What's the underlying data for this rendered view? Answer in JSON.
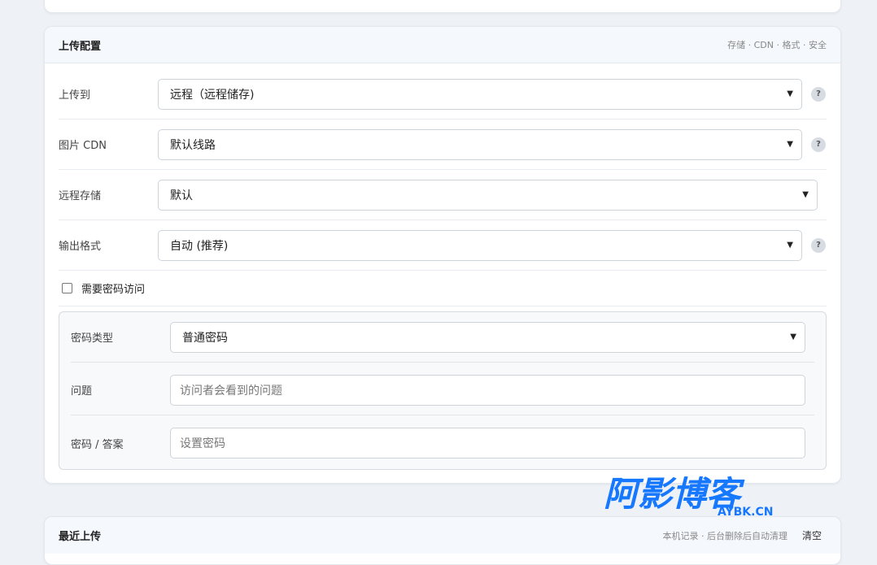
{
  "upload_config": {
    "title": "上传配置",
    "subtitle": "存储 · CDN · 格式 · 安全",
    "upload_to": {
      "label": "上传到",
      "value": "远程（远程储存)"
    },
    "image_cdn": {
      "label": "图片 CDN",
      "value": "默认线路"
    },
    "remote_storage": {
      "label": "远程存储",
      "value": "默认"
    },
    "output_format": {
      "label": "输出格式",
      "value": "自动 (推荐)"
    },
    "help_mark": "?",
    "password_required": {
      "label": "需要密码访问",
      "checked": false
    },
    "password_panel": {
      "type": {
        "label": "密码类型",
        "value": "普通密码"
      },
      "question": {
        "label": "问题",
        "placeholder": "访问者会看到的问题"
      },
      "answer": {
        "label": "密码 / 答案",
        "placeholder": "设置密码"
      }
    }
  },
  "recent_uploads": {
    "title": "最近上传",
    "subtitle": "本机记录 · 后台删除后自动清理",
    "clear_label": "清空"
  },
  "watermark": {
    "main": "阿影博客",
    "domain": "AYBK.CN",
    "color": "#1677ff"
  }
}
